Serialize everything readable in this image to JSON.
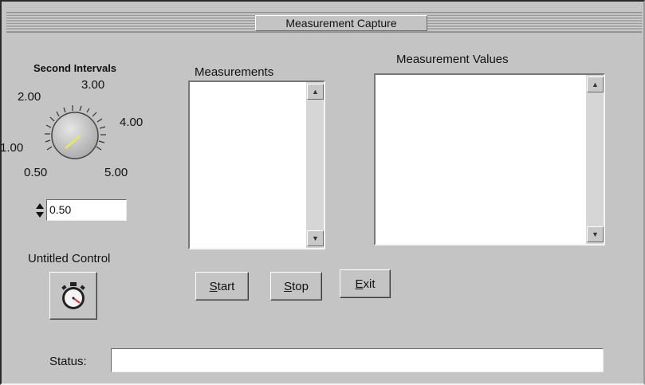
{
  "window": {
    "title": "Measurement Capture"
  },
  "knob": {
    "label": "Second Intervals",
    "ticks": [
      "0.50",
      "1.00",
      "2.00",
      "3.00",
      "4.00",
      "5.00"
    ],
    "value": "0.50"
  },
  "measurements": {
    "label": "Measurements"
  },
  "measurement_values": {
    "label": "Measurement Values"
  },
  "untitled_control": {
    "label": "Untitled Control"
  },
  "buttons": {
    "start_prefix": "S",
    "start_rest": "tart",
    "stop_prefix": "S",
    "stop_rest": "top",
    "exit_prefix": "E",
    "exit_rest": "xit"
  },
  "status": {
    "label": "Status:",
    "value": ""
  }
}
